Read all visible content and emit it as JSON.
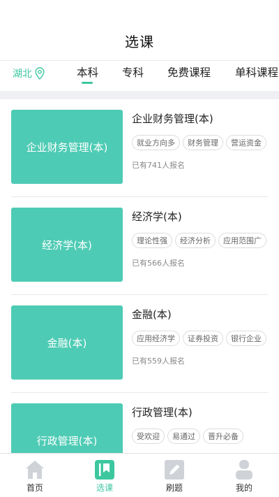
{
  "header": {
    "title": "选课"
  },
  "location": {
    "label": "湖北"
  },
  "tabs": [
    {
      "label": "本科"
    },
    {
      "label": "专科"
    },
    {
      "label": "免费课程"
    },
    {
      "label": "单科课程"
    }
  ],
  "courses": [
    {
      "thumb_label": "企业财务管理(本)",
      "name": "企业财务管理(本)",
      "tags": [
        "就业方向多",
        "财务管理",
        "营运资金"
      ],
      "enrolled": "已有741人报名"
    },
    {
      "thumb_label": "经济学(本)",
      "name": "经济学(本)",
      "tags": [
        "理论性强",
        "经济分析",
        "应用范围广"
      ],
      "enrolled": "已有566人报名"
    },
    {
      "thumb_label": "金融(本)",
      "name": "金融(本)",
      "tags": [
        "应用经济学",
        "证券投资",
        "银行企业"
      ],
      "enrolled": "已有559人报名"
    },
    {
      "thumb_label": "行政管理(本)",
      "name": "行政管理(本)",
      "tags": [
        "受欢迎",
        "易通过",
        "晋升必备"
      ],
      "enrolled": ""
    }
  ],
  "bottom_nav": [
    {
      "label": "首页",
      "icon": "home-icon"
    },
    {
      "label": "选课",
      "icon": "bookmark-icon"
    },
    {
      "label": "刷题",
      "icon": "pencil-icon"
    },
    {
      "label": "我的",
      "icon": "user-icon"
    }
  ],
  "colors": {
    "accent": "#3cc79f",
    "thumb": "#4ecbb4",
    "inactive_icon": "#cfd3d8"
  }
}
